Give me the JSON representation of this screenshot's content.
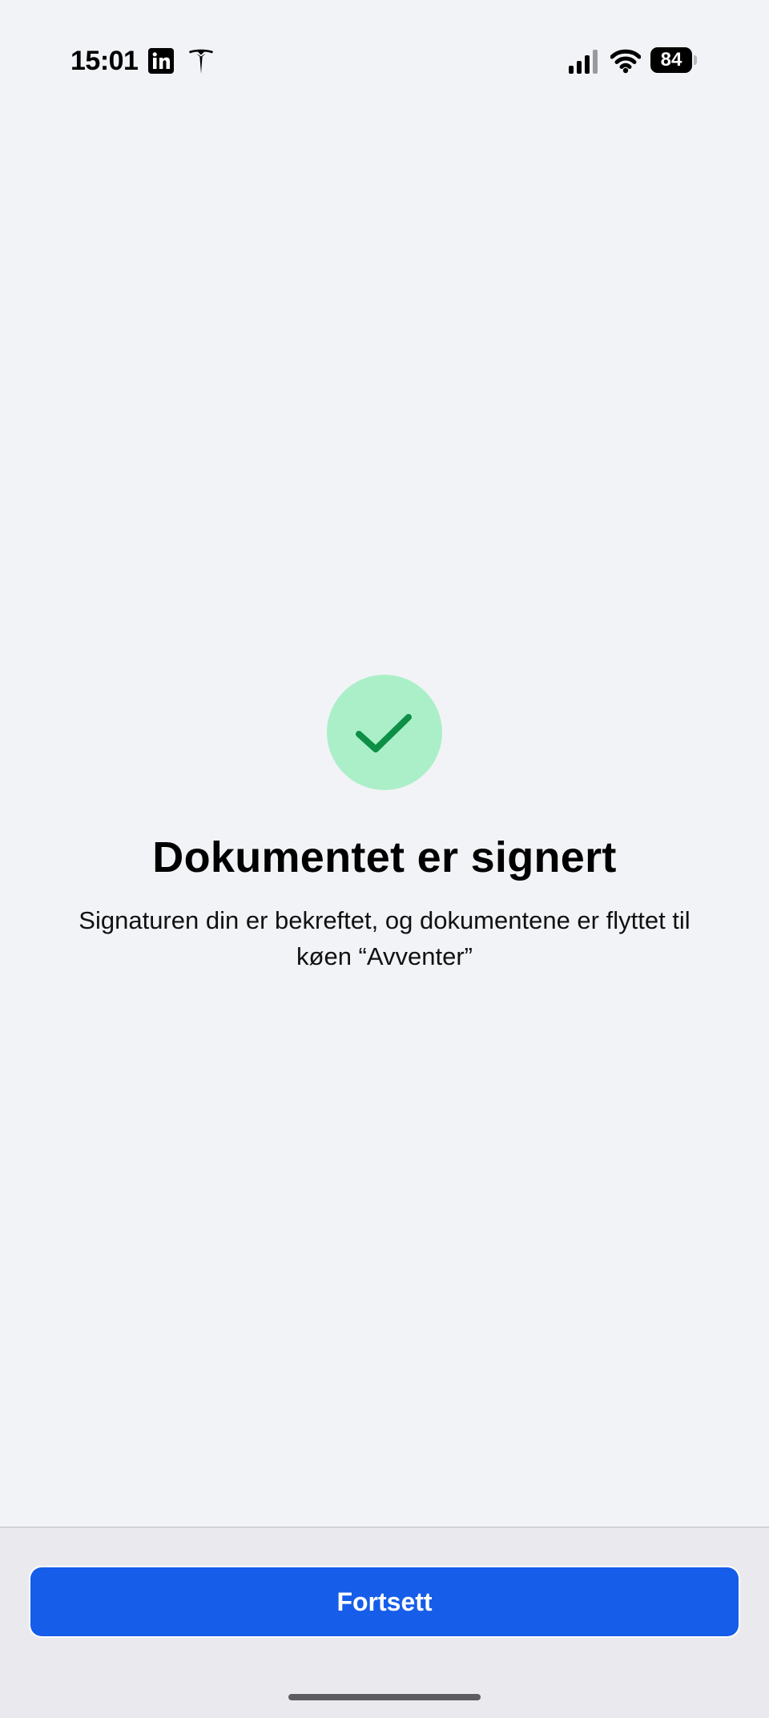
{
  "status_bar": {
    "time": "15:01",
    "battery_level": "84",
    "icons": [
      "linkedin-icon",
      "tesla-icon",
      "signal-icon",
      "wifi-icon",
      "battery-icon"
    ]
  },
  "success": {
    "icon": "checkmark-icon",
    "title": "Dokumentet er signert",
    "message": "Signaturen din er bekreftet, og dokumentene er flyttet til køen “Avventer”"
  },
  "footer": {
    "continue_label": "Fortsett"
  },
  "colors": {
    "background": "#f2f3f7",
    "success_circle": "#abefc8",
    "checkmark": "#0d8f46",
    "primary_button": "#165de9"
  }
}
